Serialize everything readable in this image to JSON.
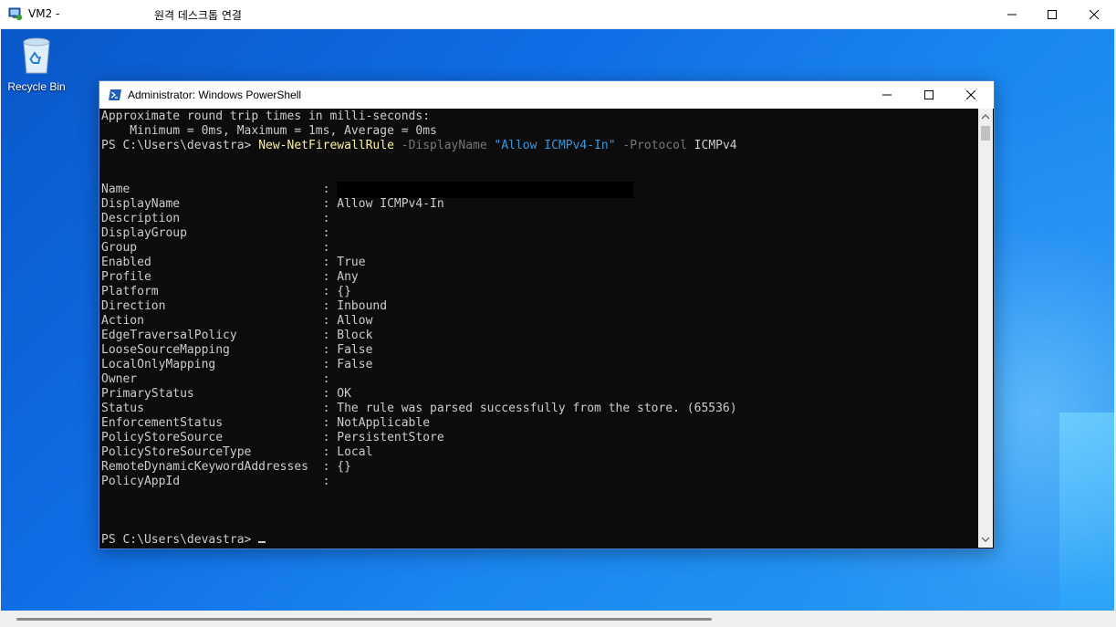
{
  "rdp": {
    "title": "VM2 -",
    "subtitle": "원격 데스크톱 연결",
    "icon": "rdp-computer-icon"
  },
  "desktop": {
    "recycle_bin_label": "Recycle Bin"
  },
  "powershell": {
    "title": "Administrator: Windows PowerShell",
    "console": {
      "ping_header": "Approximate round trip times in milli-seconds:",
      "ping_stats": "    Minimum = 0ms, Maximum = 1ms, Average = 0ms",
      "prompt": "PS C:\\Users\\devastra>",
      "command": {
        "cmdlet": "New-NetFirewallRule",
        "param1": "-DisplayName",
        "value1": "\"Allow ICMPv4-In\"",
        "param2": "-Protocol",
        "value2": "ICMPv4"
      },
      "properties": [
        {
          "name": "Name",
          "value": ""
        },
        {
          "name": "DisplayName",
          "value": "Allow ICMPv4-In"
        },
        {
          "name": "Description",
          "value": ""
        },
        {
          "name": "DisplayGroup",
          "value": ""
        },
        {
          "name": "Group",
          "value": ""
        },
        {
          "name": "Enabled",
          "value": "True"
        },
        {
          "name": "Profile",
          "value": "Any"
        },
        {
          "name": "Platform",
          "value": "{}"
        },
        {
          "name": "Direction",
          "value": "Inbound"
        },
        {
          "name": "Action",
          "value": "Allow"
        },
        {
          "name": "EdgeTraversalPolicy",
          "value": "Block"
        },
        {
          "name": "LooseSourceMapping",
          "value": "False"
        },
        {
          "name": "LocalOnlyMapping",
          "value": "False"
        },
        {
          "name": "Owner",
          "value": ""
        },
        {
          "name": "PrimaryStatus",
          "value": "OK"
        },
        {
          "name": "Status",
          "value": "The rule was parsed successfully from the store. (65536)"
        },
        {
          "name": "EnforcementStatus",
          "value": "NotApplicable"
        },
        {
          "name": "PolicyStoreSource",
          "value": "PersistentStore"
        },
        {
          "name": "PolicyStoreSourceType",
          "value": "Local"
        },
        {
          "name": "RemoteDynamicKeywordAddresses",
          "value": "{}"
        },
        {
          "name": "PolicyAppId",
          "value": ""
        }
      ],
      "final_prompt": "PS C:\\Users\\devastra>"
    }
  },
  "colors": {
    "console_bg": "#0c0c0c",
    "console_fg": "#cccccc",
    "cmdlet": "#f9f1a5",
    "param": "#767676",
    "string": "#3a96dd",
    "desktop": "#0f6ee6"
  }
}
